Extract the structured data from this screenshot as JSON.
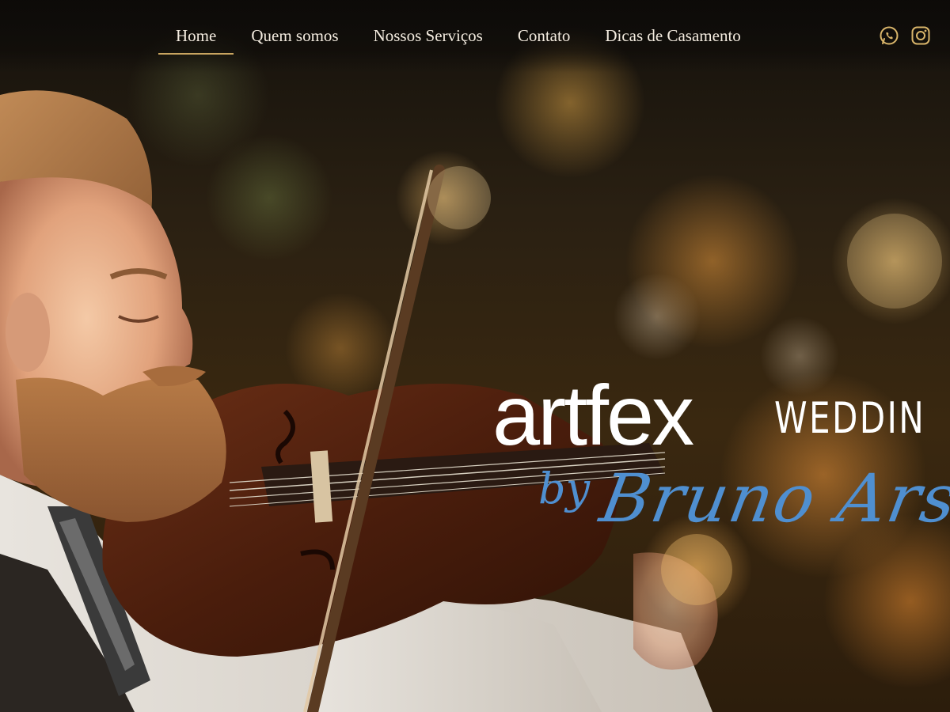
{
  "nav": {
    "items": [
      {
        "label": "Home",
        "active": true
      },
      {
        "label": "Quem somos",
        "active": false
      },
      {
        "label": "Nossos Serviços",
        "active": false
      },
      {
        "label": "Contato",
        "active": false
      },
      {
        "label": "Dicas de Casamento",
        "active": false
      }
    ],
    "social": [
      {
        "icon": "whatsapp-icon"
      },
      {
        "icon": "instagram-icon"
      }
    ],
    "colors": {
      "text": "#f4ece0",
      "underline": "#c9a560",
      "icons": "#d9b56a"
    }
  },
  "hero": {
    "image": "violinist-with-bokeh-background",
    "logo": {
      "brand": "artfex",
      "tagline": "WEDDIN",
      "by": "by",
      "signature": "Bruno Arsky",
      "brand_color": "#ffffff",
      "signature_color": "#4f8fd0"
    }
  }
}
